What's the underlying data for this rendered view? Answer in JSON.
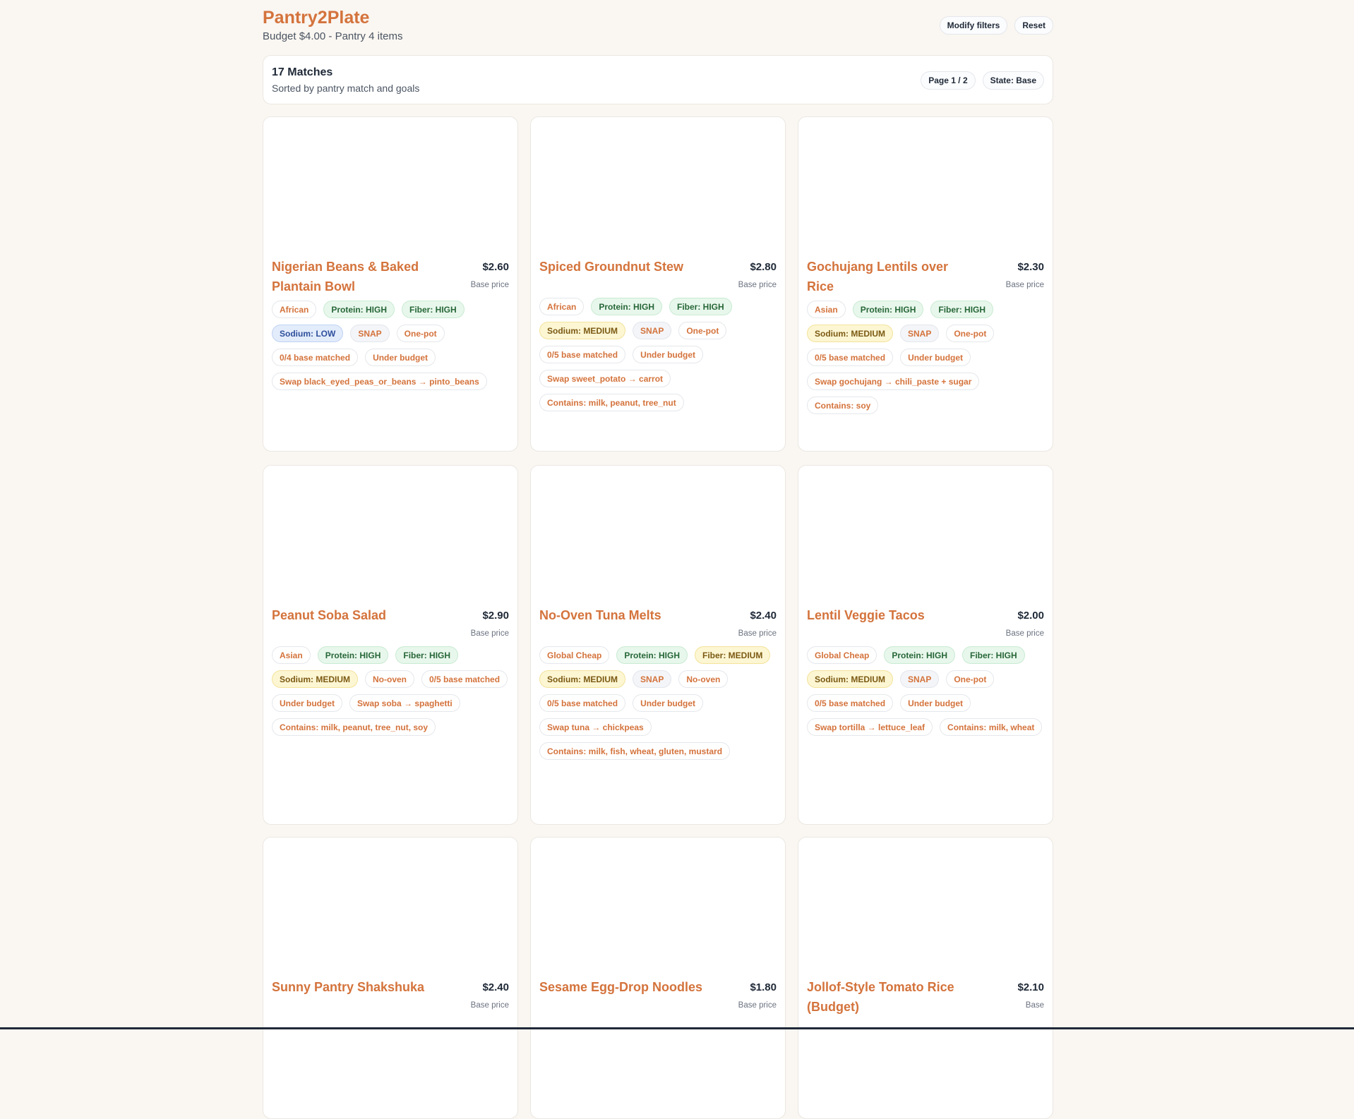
{
  "app": {
    "title": "Pantry2Plate",
    "subtitle": "Budget $4.00 - Pantry 4 items"
  },
  "header_actions": {
    "modify_label": "Modify filters",
    "reset_label": "Reset"
  },
  "summary": {
    "title": "17 Matches",
    "subtitle": "Sorted by pantry match and goals",
    "page_label": "Page 1 / 2",
    "state_label": "State: Base"
  },
  "colors": {
    "accent": "#d4733c",
    "background": "#faf6f1",
    "high": "#e8f7ec",
    "medium": "#fdf6d3",
    "low": "#e3ecfb"
  },
  "cards": [
    {
      "title": "Nigerian Beans & Baked Plantain Bowl",
      "price": "$2.60",
      "price_label": "Base price",
      "tags": [
        {
          "text": "African",
          "style": "plain"
        },
        {
          "text": "Protein: HIGH",
          "style": "green"
        },
        {
          "text": "Fiber: HIGH",
          "style": "green"
        },
        {
          "text": "Sodium: LOW",
          "style": "blue"
        },
        {
          "text": "SNAP",
          "style": "grey"
        },
        {
          "text": "One-pot",
          "style": "plain"
        },
        {
          "text": "0/4 base matched",
          "style": "plain"
        },
        {
          "text": "Under budget",
          "style": "plain"
        },
        {
          "text": "Swap black_eyed_peas_or_beans → pinto_beans",
          "style": "plain"
        }
      ]
    },
    {
      "title": "Spiced Groundnut Stew",
      "price": "$2.80",
      "price_label": "Base price",
      "tags": [
        {
          "text": "African",
          "style": "plain"
        },
        {
          "text": "Protein: HIGH",
          "style": "green"
        },
        {
          "text": "Fiber: HIGH",
          "style": "green"
        },
        {
          "text": "Sodium: MEDIUM",
          "style": "yellow"
        },
        {
          "text": "SNAP",
          "style": "grey"
        },
        {
          "text": "One-pot",
          "style": "plain"
        },
        {
          "text": "0/5 base matched",
          "style": "plain"
        },
        {
          "text": "Under budget",
          "style": "plain"
        },
        {
          "text": "Swap sweet_potato → carrot",
          "style": "plain"
        },
        {
          "text": "Contains: milk, peanut, tree_nut",
          "style": "plain"
        }
      ]
    },
    {
      "title": "Gochujang Lentils over Rice",
      "price": "$2.30",
      "price_label": "Base price",
      "tags": [
        {
          "text": "Asian",
          "style": "plain"
        },
        {
          "text": "Protein: HIGH",
          "style": "green"
        },
        {
          "text": "Fiber: HIGH",
          "style": "green"
        },
        {
          "text": "Sodium: MEDIUM",
          "style": "yellow"
        },
        {
          "text": "SNAP",
          "style": "grey"
        },
        {
          "text": "One-pot",
          "style": "plain"
        },
        {
          "text": "0/5 base matched",
          "style": "plain"
        },
        {
          "text": "Under budget",
          "style": "plain"
        },
        {
          "text": "Swap gochujang → chili_paste + sugar",
          "style": "plain"
        },
        {
          "text": "Contains: soy",
          "style": "plain"
        }
      ]
    },
    {
      "title": "Peanut Soba Salad",
      "price": "$2.90",
      "price_label": "Base price",
      "tags": [
        {
          "text": "Asian",
          "style": "plain"
        },
        {
          "text": "Protein: HIGH",
          "style": "green"
        },
        {
          "text": "Fiber: HIGH",
          "style": "green"
        },
        {
          "text": "Sodium: MEDIUM",
          "style": "yellow"
        },
        {
          "text": "No-oven",
          "style": "plain"
        },
        {
          "text": "0/5 base matched",
          "style": "plain"
        },
        {
          "text": "Under budget",
          "style": "plain"
        },
        {
          "text": "Swap soba → spaghetti",
          "style": "plain"
        },
        {
          "text": "Contains: milk, peanut, tree_nut, soy",
          "style": "plain"
        }
      ]
    },
    {
      "title": "No-Oven Tuna Melts",
      "price": "$2.40",
      "price_label": "Base price",
      "tags": [
        {
          "text": "Global Cheap",
          "style": "plain"
        },
        {
          "text": "Protein: HIGH",
          "style": "green"
        },
        {
          "text": "Fiber: MEDIUM",
          "style": "yellow"
        },
        {
          "text": "Sodium: MEDIUM",
          "style": "yellow"
        },
        {
          "text": "SNAP",
          "style": "grey"
        },
        {
          "text": "No-oven",
          "style": "plain"
        },
        {
          "text": "0/5 base matched",
          "style": "plain"
        },
        {
          "text": "Under budget",
          "style": "plain"
        },
        {
          "text": "Swap tuna → chickpeas",
          "style": "plain"
        },
        {
          "text": "Contains: milk, fish, wheat, gluten, mustard",
          "style": "plain"
        }
      ]
    },
    {
      "title": "Lentil Veggie Tacos",
      "price": "$2.00",
      "price_label": "Base price",
      "tags": [
        {
          "text": "Global Cheap",
          "style": "plain"
        },
        {
          "text": "Protein: HIGH",
          "style": "green"
        },
        {
          "text": "Fiber: HIGH",
          "style": "green"
        },
        {
          "text": "Sodium: MEDIUM",
          "style": "yellow"
        },
        {
          "text": "SNAP",
          "style": "grey"
        },
        {
          "text": "One-pot",
          "style": "plain"
        },
        {
          "text": "0/5 base matched",
          "style": "plain"
        },
        {
          "text": "Under budget",
          "style": "plain"
        },
        {
          "text": "Swap tortilla → lettuce_leaf",
          "style": "plain"
        },
        {
          "text": "Contains: milk, wheat",
          "style": "plain"
        }
      ]
    },
    {
      "title": "Sunny Pantry Shakshuka",
      "price": "$2.40",
      "price_label": "Base price",
      "tags": []
    },
    {
      "title": "Sesame Egg-Drop Noodles",
      "price": "$1.80",
      "price_label": "Base price",
      "tags": []
    },
    {
      "title": "Jollof-Style Tomato Rice (Budget)",
      "price": "$2.10",
      "price_label": "Base",
      "tags": []
    }
  ]
}
